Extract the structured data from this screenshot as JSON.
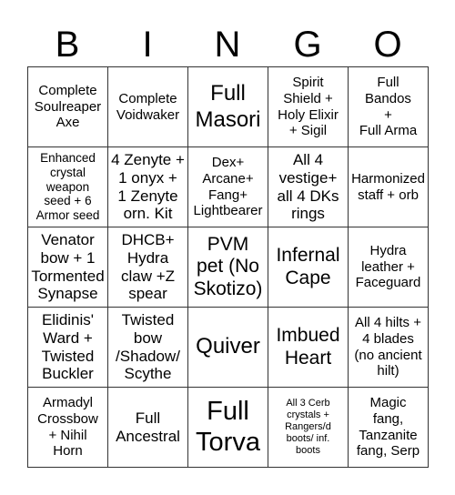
{
  "header": {
    "letters": [
      "B",
      "I",
      "N",
      "G",
      "O"
    ]
  },
  "board": {
    "rows": [
      [
        "Complete\nSoulreaper\nAxe",
        "Complete\nVoidwaker",
        "Full\nMasori",
        "Spirit\nShield +\nHoly Elixir\n+ Sigil",
        "Full\nBandos\n+\nFull Arma"
      ],
      [
        "Enhanced\ncrystal\nweapon\nseed + 6\nArmor seed",
        "4 Zenyte +\n1 onyx +\n1 Zenyte\norn. Kit",
        "Dex+\nArcane+\nFang+\nLightbearer",
        "All 4\nvestige+\nall 4 DKs\nrings",
        "Harmonized\nstaff + orb"
      ],
      [
        "Venator\nbow + 1\nTormented\nSynapse",
        "DHCB+\nHydra\nclaw +Z\nspear",
        "PVM\npet (No\nSkotizo)",
        "Infernal\nCape",
        "Hydra\nleather +\nFaceguard"
      ],
      [
        "Elidinis'\nWard +\nTwisted\nBuckler",
        "Twisted\nbow\n/Shadow/\nScythe",
        "Quiver",
        "Imbued\nHeart",
        "All 4 hilts +\n4 blades\n(no ancient\nhilt)"
      ],
      [
        "Armadyl\nCrossbow\n+ Nihil\nHorn",
        "Full\nAncestral",
        "Full\nTorva",
        "All 3 Cerb\ncrystals +\nRangers/d\nboots/ inf.\nboots",
        "Magic\nfang,\nTanzanite\nfang, Serp"
      ]
    ]
  }
}
